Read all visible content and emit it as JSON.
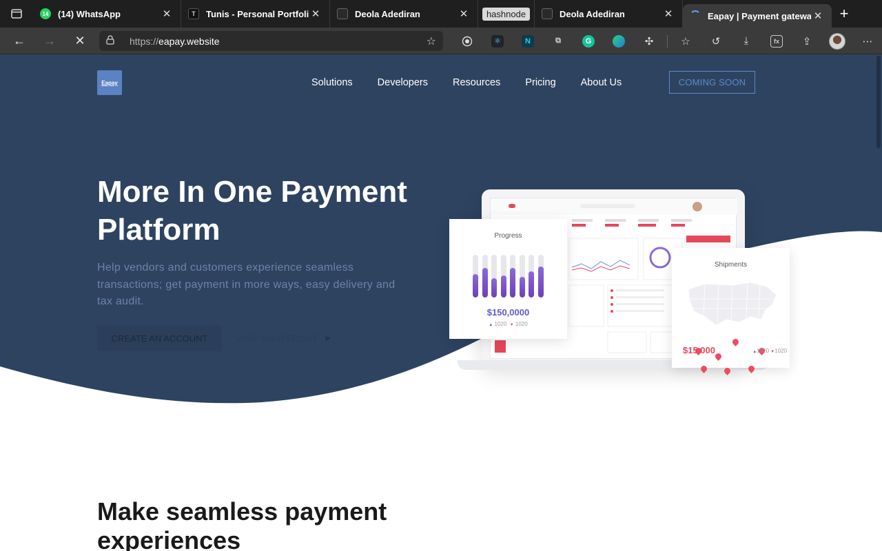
{
  "browser": {
    "tabs": [
      {
        "title": "(14) WhatsApp",
        "badge": "14",
        "favicon": "whatsapp-icon"
      },
      {
        "title": "Tunis - Personal Portfolio I",
        "favicon": "t-icon"
      },
      {
        "title": "Deola Adediran",
        "favicon": "page-icon"
      },
      {
        "title": "hashnode",
        "favicon": "hashnode-icon"
      },
      {
        "title": "Deola Adediran",
        "favicon": "page-icon"
      },
      {
        "title": "Eapay | Payment gateway",
        "favicon": "loading-icon",
        "active": true
      }
    ],
    "url_scheme": "https://",
    "url_host": "eapay.website",
    "extensions": [
      "record-icon",
      "react-icon",
      "n-icon",
      "copy-icon",
      "grammarly-icon",
      "edge-icon",
      "puzzle-icon",
      "favorites-icon",
      "history-icon",
      "download-icon",
      "math-icon",
      "share-icon",
      "profile-avatar",
      "more-icon"
    ]
  },
  "site": {
    "logo_text": "Eapay",
    "nav": [
      "Solutions",
      "Developers",
      "Resources",
      "Pricing",
      "About Us"
    ],
    "coming_soon": "COMING SOON",
    "hero": {
      "title": "More In One Payment Platform",
      "subtitle": "Help vendors and customers experience seamless transactions; get payment in more ways, easy delivery and tax audit.",
      "primary_button": "CREATE AN ACCOUNT",
      "secondary_button": "VISIT SHOPFRONT"
    },
    "mockup": {
      "progress_card": {
        "title": "Progress",
        "amount": "$150,0000",
        "legend_up": "1020",
        "legend_down": "1020",
        "bars": [
          0.55,
          0.7,
          0.45,
          0.52,
          0.7,
          0.48,
          0.62,
          0.72
        ]
      },
      "shipments_card": {
        "title": "Shipments",
        "amount": "$15,000",
        "legend_up": "1020",
        "legend_down": "1020"
      }
    },
    "section2_title": "Make seamless payment experiences"
  },
  "colors": {
    "hero_bg": "#2e4360",
    "accent": "#5a8ad0",
    "chrome_dark": "#1f1f1f",
    "chrome_toolbar": "#3b3b3b"
  }
}
